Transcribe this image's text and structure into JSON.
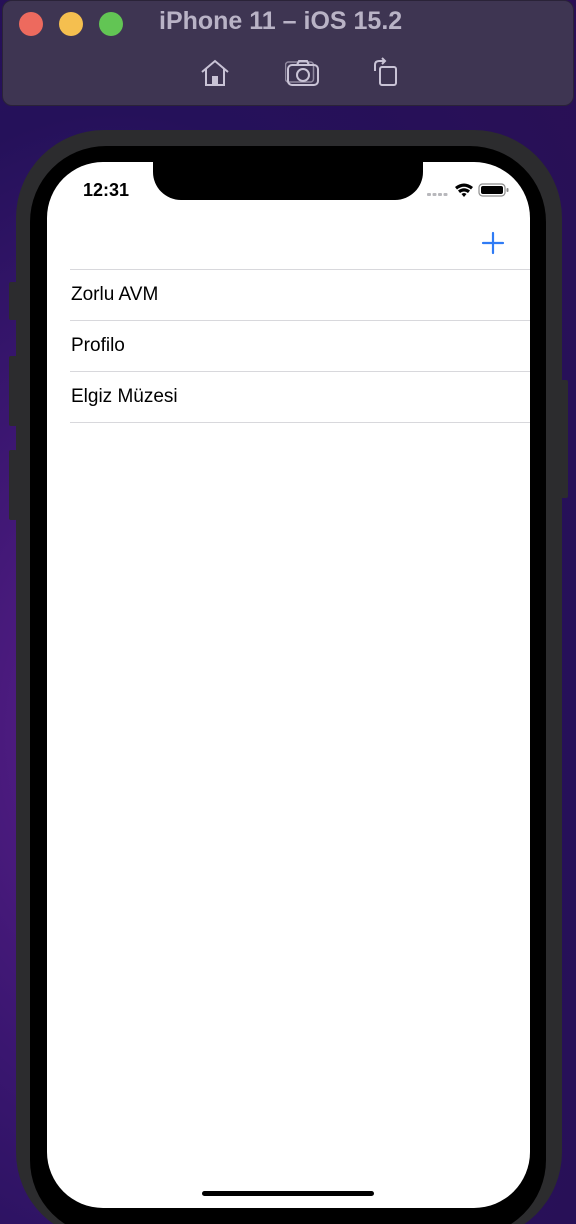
{
  "simulator": {
    "title": "iPhone 11 – iOS 15.2",
    "controls": [
      {
        "name": "home-icon",
        "label": "Home"
      },
      {
        "name": "camera-icon",
        "label": "Screenshot"
      },
      {
        "name": "rotate-icon",
        "label": "Rotate"
      }
    ]
  },
  "status_bar": {
    "time": "12:31"
  },
  "nav_bar": {
    "add_icon": "plus-icon",
    "accent_color": "#2f7bf5"
  },
  "list": {
    "items": [
      {
        "label": "Zorlu AVM"
      },
      {
        "label": "Profilo"
      },
      {
        "label": "Elgiz Müzesi"
      }
    ]
  }
}
